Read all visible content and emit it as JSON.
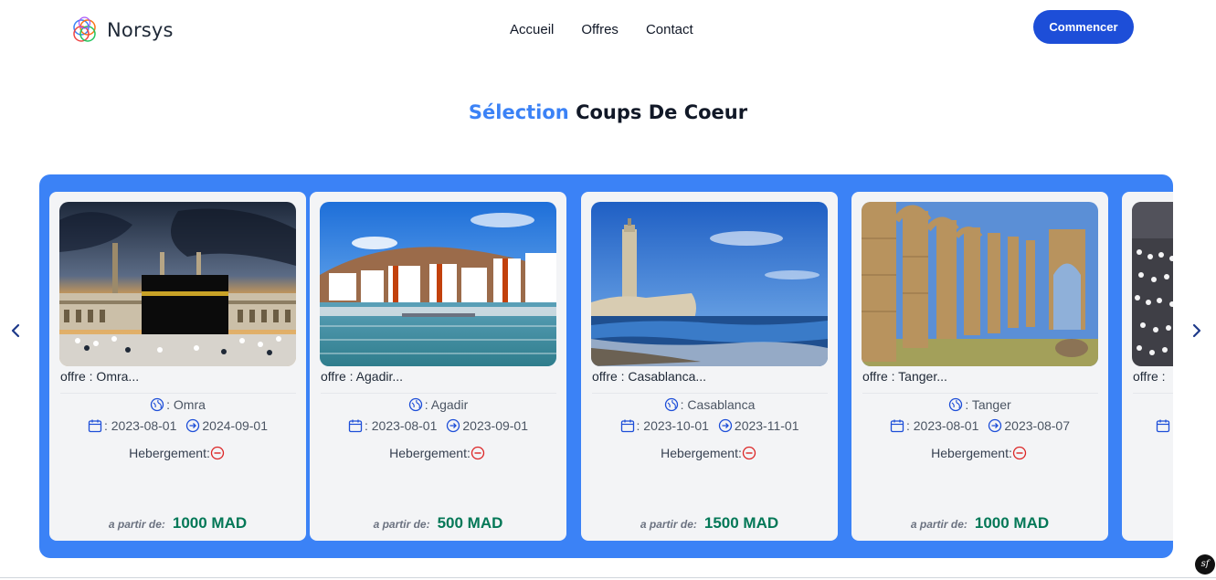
{
  "brand": {
    "name": "Norsys",
    "logo_icon": "overlapping-circles-logo"
  },
  "nav": {
    "links": [
      "Accueil",
      "Offres",
      "Contact"
    ],
    "cta_label": "Commencer"
  },
  "section": {
    "title_accent": "Sélection",
    "title_rest": "Coups De Coeur"
  },
  "colors": {
    "accent": "#3b82f6",
    "cta": "#1d4ed8",
    "price": "#047857",
    "no_lodging": "#dc2626"
  },
  "carousel": {
    "prev_icon": "chevron-left-icon",
    "next_icon": "chevron-right-icon",
    "cards": [
      {
        "title": "offre : Omra...",
        "destination": ": Omra",
        "date_start": ": 2023-08-01",
        "date_end": "2024-09-01",
        "hebergement_label": "Hebergement:",
        "price_label": "a partir de:",
        "price": "1000 MAD",
        "image": "kaaba-mecca-photo"
      },
      {
        "title": "offre : Agadir...",
        "destination": ": Agadir",
        "date_start": ": 2023-08-01",
        "date_end": "2023-09-01",
        "hebergement_label": "Hebergement:",
        "price_label": "a partir de:",
        "price": "500 MAD",
        "image": "agadir-marina-photo"
      },
      {
        "title": "offre : Casablanca...",
        "destination": ": Casablanca",
        "date_start": ": 2023-10-01",
        "date_end": "2023-11-01",
        "hebergement_label": "Hebergement:",
        "price_label": "a partir de:",
        "price": "1500 MAD",
        "image": "hassan-ii-mosque-photo"
      },
      {
        "title": "offre : Tanger...",
        "destination": ": Tanger",
        "date_start": ": 2023-08-01",
        "date_end": "2023-08-07",
        "hebergement_label": "Hebergement:",
        "price_label": "a partir de:",
        "price": "1000 MAD",
        "image": "roman-ruins-photo"
      },
      {
        "title": "offre :",
        "image": "crowd-photo"
      }
    ]
  },
  "debug_badge": "sf"
}
